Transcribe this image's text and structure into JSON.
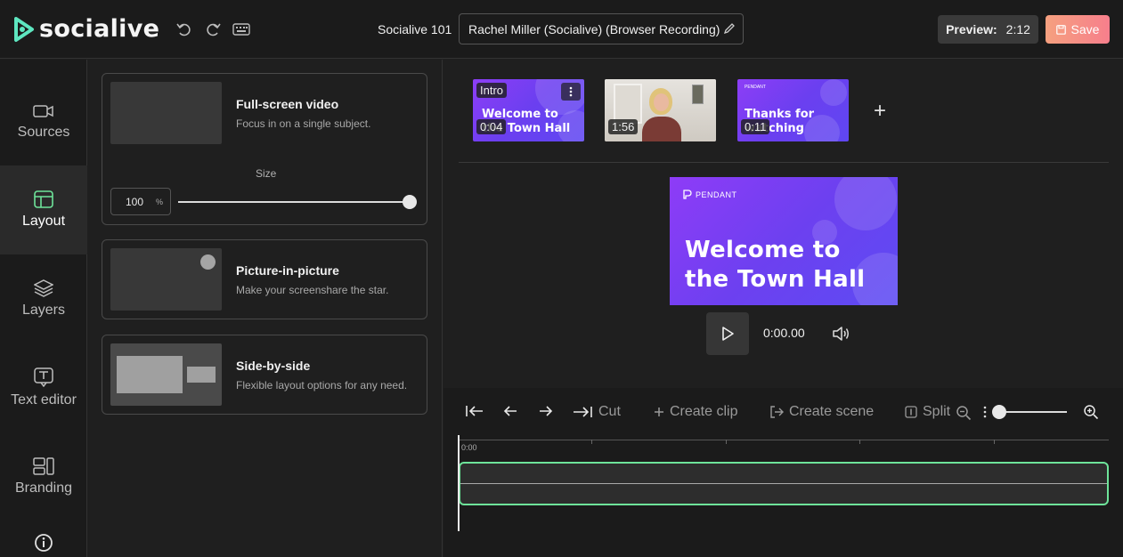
{
  "header": {
    "logo_text": "socialive",
    "project_name": "Socialive 101",
    "recording_title": "Rachel Miller (Socialive) (Browser Recording)",
    "preview_label": "Preview:",
    "preview_duration": "2:12",
    "save_label": "Save",
    "icons": [
      "undo-icon",
      "redo-icon",
      "keyboard-icon",
      "pencil-icon",
      "save-icon"
    ]
  },
  "nav": {
    "items": [
      {
        "label": "Sources",
        "icon": "video-camera-icon"
      },
      {
        "label": "Layout",
        "icon": "layout-icon",
        "active": true
      },
      {
        "label": "Layers",
        "icon": "layers-icon"
      },
      {
        "label": "Text editor",
        "icon": "text-icon"
      },
      {
        "label": "Branding",
        "icon": "branding-icon"
      }
    ],
    "info_icon": "info-icon"
  },
  "layout_panel": {
    "options": [
      {
        "title": "Full-screen video",
        "description": "Focus in on a single subject."
      },
      {
        "title": "Picture-in-picture",
        "description": "Make your screenshare the star."
      },
      {
        "title": "Side-by-side",
        "description": "Flexible layout options for any need."
      }
    ],
    "size_label": "Size",
    "size_value": "100",
    "size_unit": "%",
    "size_slider_value_pct": 100
  },
  "scenes": [
    {
      "label": "Intro",
      "line1": "Welcome to",
      "line2": "the Town Hall",
      "duration": "0:04",
      "selected": true
    },
    {
      "label": "",
      "duration": "1:56",
      "kind": "video"
    },
    {
      "logo": "PENDANT",
      "line1": "Thanks for",
      "line2": "watching",
      "duration": "0:11"
    }
  ],
  "preview": {
    "logo": "PENDANT",
    "line1": "Welcome to",
    "line2": "the Town Hall",
    "time": "0:00.00"
  },
  "timeline": {
    "tools": {
      "cut": "Cut",
      "create_clip": "Create clip",
      "create_scene": "Create scene",
      "split": "Split"
    },
    "ruler_start": "0:00",
    "zoom_value_pct": 0
  },
  "colors": {
    "accent_green": "#6ee49a",
    "save_gradient_start": "#f5a07f",
    "save_gradient_end": "#f77f8c",
    "scene_purple": "#7b3ff4"
  }
}
